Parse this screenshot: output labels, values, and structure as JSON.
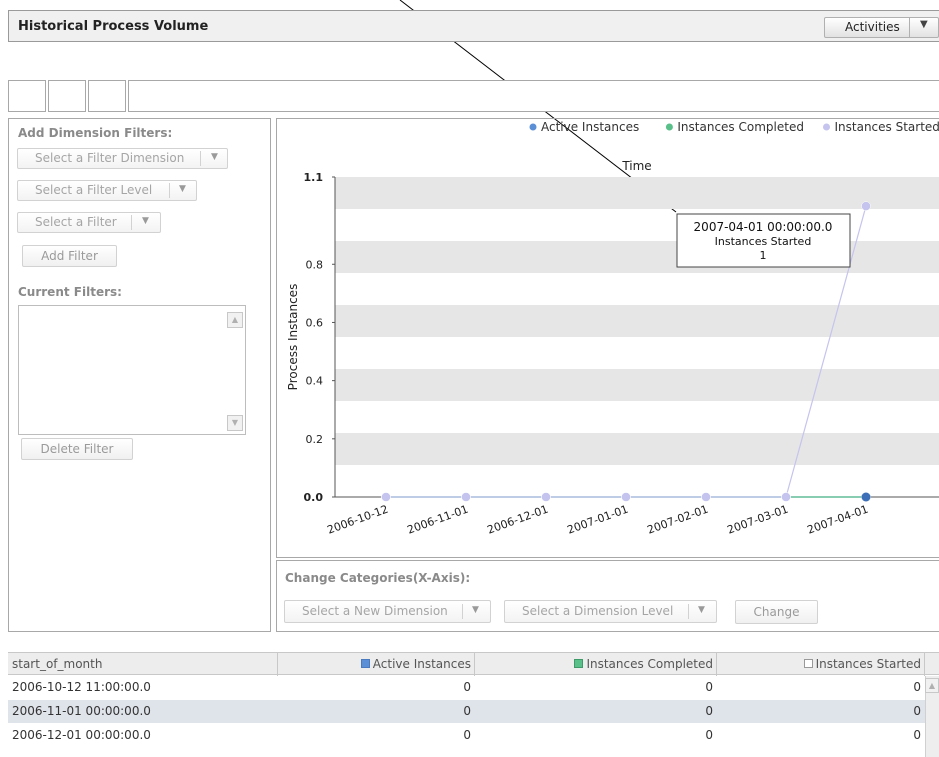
{
  "header": {
    "title": "Historical Process Volume",
    "activities_label": "Activities"
  },
  "filters": {
    "add_title": "Add Dimension Filters:",
    "select_dimension": "Select a Filter Dimension",
    "select_level": "Select a Filter Level",
    "select_filter": "Select a Filter",
    "add_button": "Add Filter",
    "current_title": "Current Filters:",
    "delete_button": "Delete Filter"
  },
  "xaxis_panel": {
    "title": "Change Categories(X-Axis):",
    "select_dimension": "Select a New Dimension",
    "select_level": "Select a Dimension Level",
    "change_button": "Change"
  },
  "chart_data": {
    "type": "line",
    "title": "Time",
    "ylabel": "Process Instances",
    "xlabel": "",
    "categories": [
      "2006-10-12",
      "2006-11-01",
      "2006-12-01",
      "2007-01-01",
      "2007-02-01",
      "2007-03-01",
      "2007-04-01"
    ],
    "y_ticks": [
      "0.0",
      "0.2",
      "0.4",
      "0.6",
      "0.8",
      "1.1"
    ],
    "ylim": [
      0,
      1.1
    ],
    "grid": "horizontal bands",
    "legend_position": "top-right",
    "series": [
      {
        "name": "Active Instances",
        "color": "#5b8fd6",
        "values": [
          0,
          0,
          0,
          0,
          0,
          0,
          0
        ]
      },
      {
        "name": "Instances Completed",
        "color": "#59c08a",
        "values": [
          0,
          0,
          0,
          0,
          0,
          0,
          0
        ]
      },
      {
        "name": "Instances Started",
        "color": "#c4c4ee",
        "values": [
          0,
          0,
          0,
          0,
          0,
          0,
          1
        ]
      }
    ],
    "tooltip": {
      "line1": "2007-04-01 00:00:00.0",
      "line2": "Instances Started",
      "line3": "1"
    }
  },
  "table": {
    "headers": [
      "start_of_month",
      "Active Instances",
      "Instances Completed",
      "Instances Started"
    ],
    "header_colors": [
      "",
      "#5b8fd6",
      "#59c08a",
      "#ffffff"
    ],
    "rows": [
      [
        "2006-10-12 11:00:00.0",
        "0",
        "0",
        "0"
      ],
      [
        "2006-11-01 00:00:00.0",
        "0",
        "0",
        "0"
      ],
      [
        "2006-12-01 00:00:00.0",
        "0",
        "0",
        "0"
      ]
    ]
  }
}
